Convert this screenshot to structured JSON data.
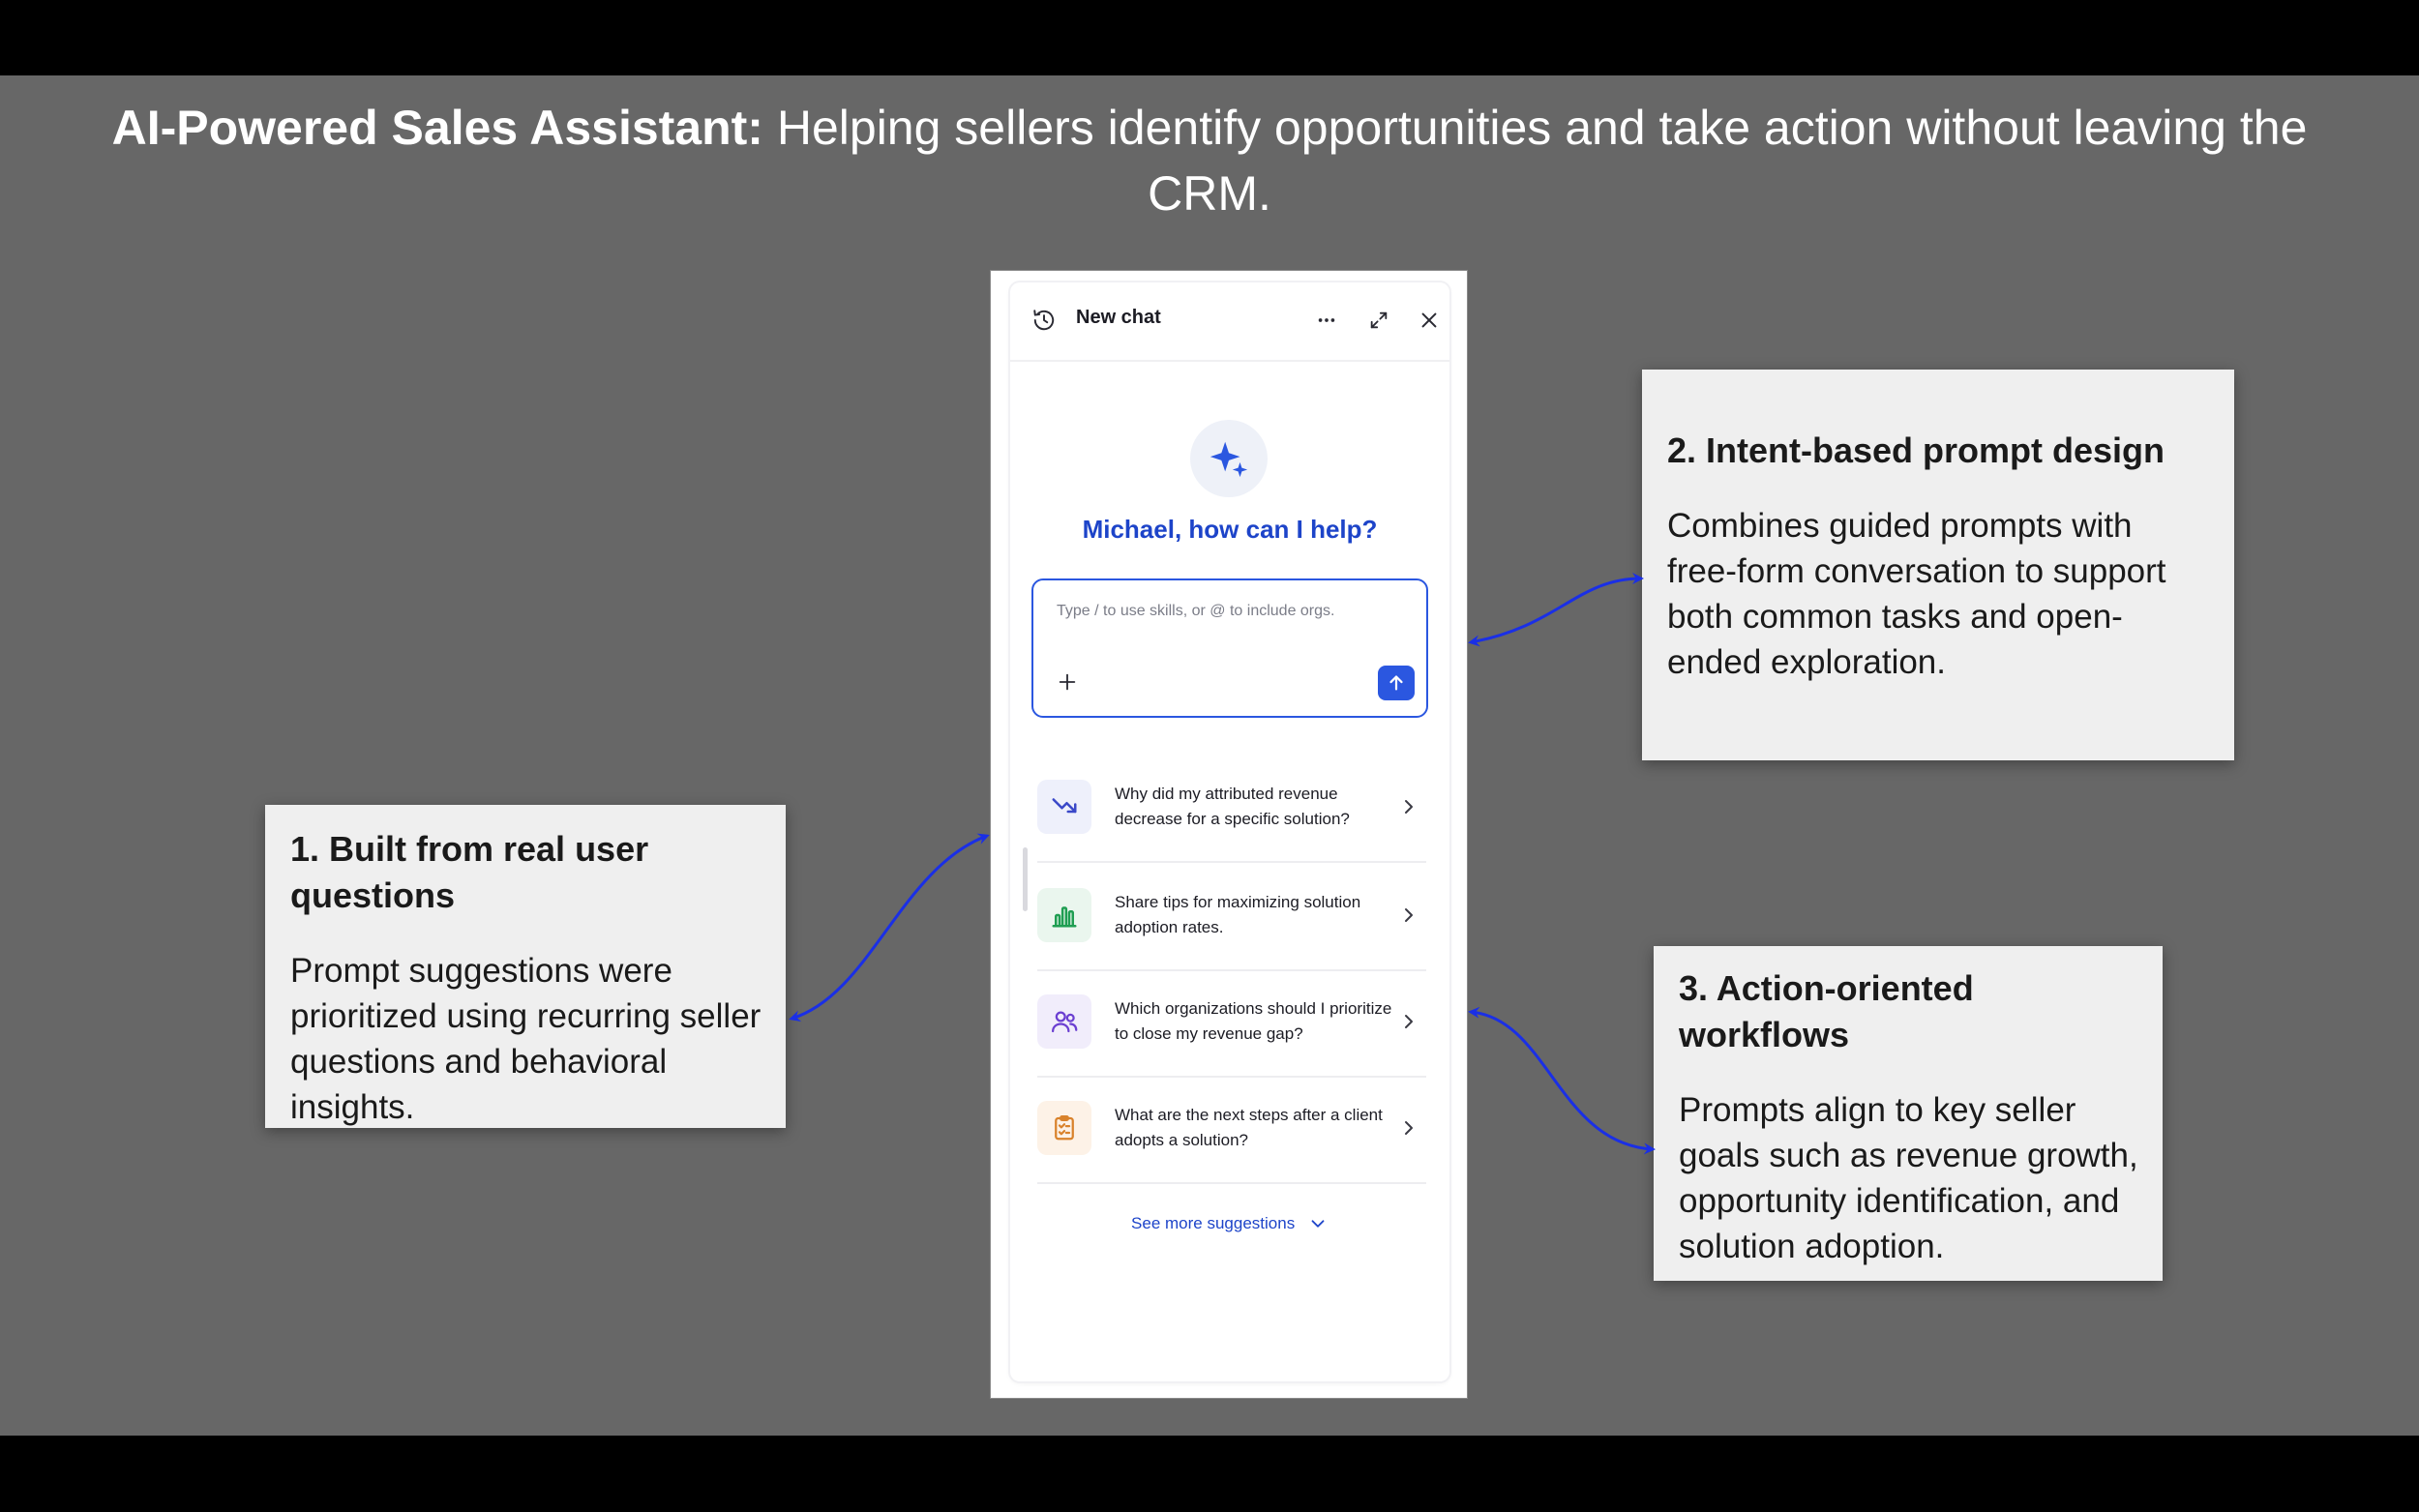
{
  "headline": {
    "bold": "AI-Powered Sales Assistant:",
    "rest": " Helping sellers identify opportunities and take action without leaving the CRM."
  },
  "chat": {
    "title": "New chat",
    "greeting": "Michael, how can I help?",
    "placeholder": "Type / to use skills, or @ to include orgs.",
    "suggestions": [
      {
        "text": "Why did my attributed revenue decrease for a specific solution?",
        "icon": "trending-down-icon",
        "color": "#3a48c8",
        "bg": "#eef0fb"
      },
      {
        "text": "Share tips for maximizing solution adoption rates.",
        "icon": "bar-chart-icon",
        "color": "#1f9e52",
        "bg": "#eaf6ee"
      },
      {
        "text": "Which organizations should I prioritize to close my revenue gap?",
        "icon": "users-icon",
        "color": "#6b3fd1",
        "bg": "#f1edfb"
      },
      {
        "text": "What are the next steps after a client adopts a solution?",
        "icon": "clipboard-check-icon",
        "color": "#d9822b",
        "bg": "#fdf2e7"
      }
    ],
    "see_more": "See more suggestions"
  },
  "callouts": {
    "c1": {
      "title": "1. Built from real user questions",
      "body": "Prompt suggestions were prioritized using recurring seller questions and behavioral insights."
    },
    "c2": {
      "title": "2. Intent-based prompt design",
      "body": "Combines guided prompts with free-form conversation to support both common tasks and open-ended exploration."
    },
    "c3": {
      "title": "3. Action-oriented workflows",
      "body": "Prompts align to key seller goals such as revenue growth, opportunity identification, and solution adoption."
    }
  },
  "colors": {
    "accent": "#2b57e0",
    "arrow": "#1a2fe6",
    "stage": "#676767"
  }
}
